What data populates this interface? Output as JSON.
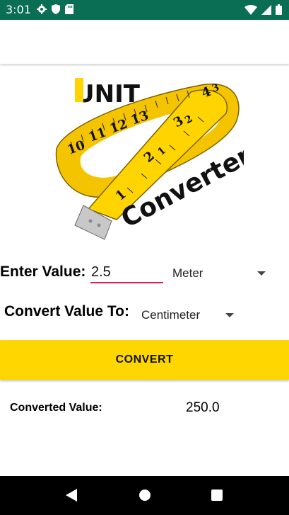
{
  "status_bar": {
    "time": "3:01",
    "left_icons": [
      "gear-icon",
      "shield-icon",
      "sd-card-icon"
    ],
    "right_icons": [
      "wifi-icon",
      "signal-icon",
      "battery-icon"
    ],
    "background": "#0a6e55"
  },
  "logo": {
    "word_1": "UNIT",
    "word_2": "Converter",
    "tape_numbers": [
      "1",
      "2",
      "3",
      "4",
      "10",
      "11",
      "12",
      "13",
      "1",
      "2",
      "3"
    ]
  },
  "form": {
    "enter_label": "Enter Value:",
    "input_value": "2.5",
    "from_unit": "Meter",
    "convert_to_label": "Convert Value To:",
    "to_unit": "Centimeter"
  },
  "button": {
    "label": "CONVERT",
    "color": "#ffd600"
  },
  "result": {
    "label": "Converted Value:",
    "value": "250.0"
  },
  "accent_color": "#d81b60"
}
